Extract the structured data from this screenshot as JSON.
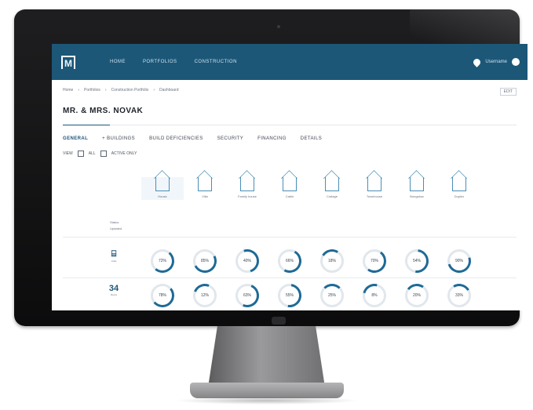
{
  "topbar": {
    "logo": "M",
    "nav": [
      "HOME",
      "PORTFOLIOS",
      "CONSTRUCTION"
    ],
    "user": "Username"
  },
  "breadcrumb": [
    "Home",
    "Portfolios",
    "Construction Portfolio",
    "Dashboard"
  ],
  "edit_label": "EDIT",
  "title": "MR. & MRS. NOVAK",
  "tabs": [
    "GENERAL",
    "+ BUILDINGS",
    "BUILD DEFICIENCIES",
    "SECURITY",
    "FINANCING",
    "DETAILS"
  ],
  "filters": [
    "VIEW",
    "ALL",
    "ACTIVE ONLY"
  ],
  "columns": [
    {
      "caption": "House"
    },
    {
      "caption": "Villa"
    },
    {
      "caption": "Family house"
    },
    {
      "caption": "Cabin"
    },
    {
      "caption": "Cottage"
    },
    {
      "caption": "Townhouse"
    },
    {
      "caption": "Bungalow"
    },
    {
      "caption": "Duplex"
    }
  ],
  "meta_labels": [
    "Status",
    "Updated"
  ],
  "rows": [
    {
      "icon": "building-icon",
      "glyph": "⌸",
      "caption": "Units",
      "values": [
        "72%",
        "85%",
        "40%",
        "66%",
        "18%",
        "70%",
        "54%",
        "90%"
      ]
    },
    {
      "icon": "floor-icon",
      "glyph": "34",
      "caption": "Floors",
      "values": [
        "78%",
        "12%",
        "63%",
        "55%",
        "25%",
        "8%",
        "20%",
        "33%"
      ]
    }
  ],
  "colors": {
    "accent": "#1c5778",
    "ring": "#1e6a96"
  }
}
